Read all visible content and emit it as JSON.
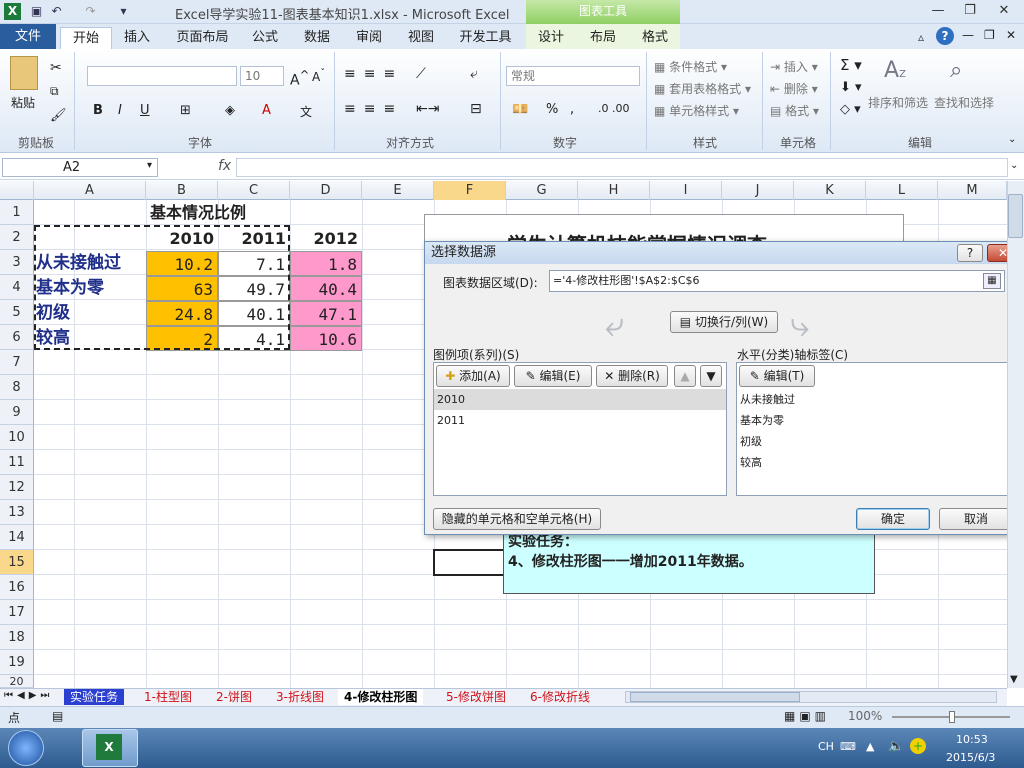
{
  "window": {
    "title": "Excel导学实验11-图表基本知识1.xlsx  -  Microsoft Excel",
    "chart_tools": "图表工具"
  },
  "tabs": [
    "文件",
    "开始",
    "插入",
    "页面布局",
    "公式",
    "数据",
    "审阅",
    "视图",
    "开发工具",
    "设计",
    "布局",
    "格式"
  ],
  "ribbon": {
    "clipboard": {
      "paste": "粘贴",
      "label": "剪贴板"
    },
    "font": {
      "size": "10",
      "bold": "B",
      "italic": "I",
      "underline": "U",
      "label": "字体"
    },
    "alignment": {
      "label": "对齐方式"
    },
    "number": {
      "format": "常规",
      "label": "数字"
    },
    "styles": {
      "conditional": "条件格式",
      "table": "套用表格格式",
      "cell": "单元格样式",
      "label": "样式"
    },
    "cells": {
      "insert": "插入",
      "delete": "删除",
      "format": "格式",
      "label": "单元格"
    },
    "editing": {
      "sort": "排序和筛选",
      "find": "查找和选择",
      "label": "编辑"
    }
  },
  "formula": {
    "name_box": "A2",
    "fx": "fx",
    "content": ""
  },
  "columns": [
    "A",
    "B",
    "C",
    "D",
    "E",
    "F",
    "G",
    "H",
    "I",
    "J",
    "K",
    "L",
    "M"
  ],
  "rows": [
    "1",
    "2",
    "3",
    "4",
    "5",
    "6",
    "7",
    "8",
    "9",
    "10",
    "11",
    "12",
    "13",
    "14",
    "15",
    "16",
    "17",
    "18",
    "19",
    "20"
  ],
  "sheet": {
    "title": "基本情况比例",
    "years": [
      "2010",
      "2011",
      "2012"
    ],
    "labels": [
      "从未接触过",
      "基本为零",
      "初级",
      "较高"
    ],
    "col2010": [
      "10.2",
      "63",
      "24.8",
      "2"
    ],
    "col2011": [
      "7.1",
      "49.7",
      "40.1",
      "4.1"
    ],
    "col2012": [
      "1.8",
      "40.4",
      "47.1",
      "10.6"
    ]
  },
  "chart_title_partial": "学生计算机技能掌握情况调查",
  "note": {
    "title": "实验任务：",
    "body": "4、修改柱形图一一增加2011年数据。"
  },
  "dialog": {
    "title": "选择数据源",
    "help": "?",
    "close": "✕",
    "range_label": "图表数据区域(D):",
    "range_value": "='4-修改柱形图'!$A$2:$C$6",
    "switch": "切换行/列(W)",
    "legend_label": "图例项(系列)(S)",
    "add": "添加(A)",
    "edit": "编辑(E)",
    "remove": "删除(R)",
    "series": [
      "2010",
      "2011"
    ],
    "axis_label": "水平(分类)轴标签(C)",
    "axis_edit": "编辑(T)",
    "categories": [
      "从未接触过",
      "基本为零",
      "初级",
      "较高"
    ],
    "hidden": "隐藏的单元格和空单元格(H)",
    "ok": "确定",
    "cancel": "取消"
  },
  "sheet_tabs": [
    "实验任务",
    "1-柱型图",
    "2-饼图",
    "3-折线图",
    "4-修改柱形图",
    "5-修改饼图",
    "6-修改折线"
  ],
  "status": {
    "mode": "点",
    "zoom": "100%"
  },
  "taskbar": {
    "lang": "CH",
    "time": "10:53",
    "date": "2015/6/3"
  }
}
